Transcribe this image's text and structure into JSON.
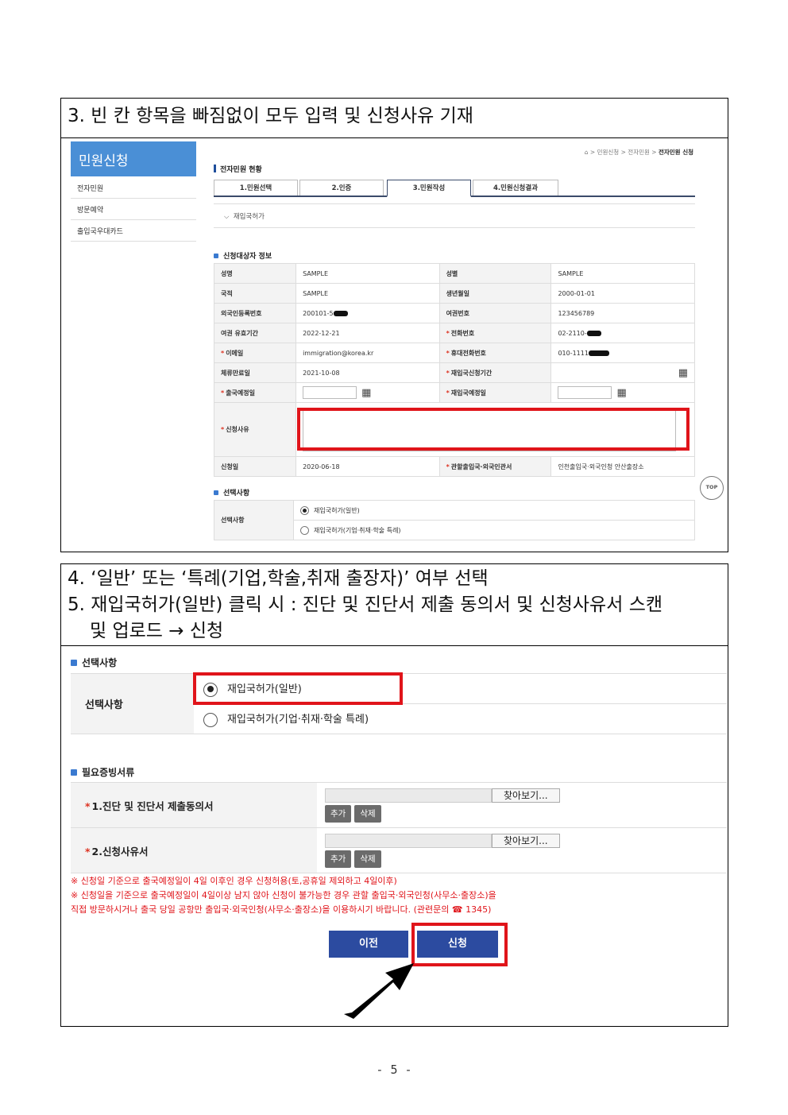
{
  "step3": {
    "title": "3. 빈 칸 항목을 빠짐없이 모두 입력 및 신청사유 기재"
  },
  "shot1": {
    "sidebar": {
      "title": "민원신청",
      "items": [
        "전자민원",
        "방문예약",
        "출입국우대카드"
      ]
    },
    "breadcrumb": {
      "home_icon": "home-icon",
      "parts": [
        "민원신청",
        "전자민원"
      ],
      "current": "전자민원 신청",
      "sep": ">"
    },
    "page_title": "전자민원 현황",
    "tabs": [
      "1.민원선택",
      "2.인증",
      "3.민원작성",
      "4.민원신청결과"
    ],
    "active_tab": 2,
    "collapse_label": "재입국허가",
    "applicant_section": "신청대상자 정보",
    "rows": [
      {
        "l1": "성명",
        "v1": "SAMPLE",
        "l2": "성별",
        "v2": "SAMPLE"
      },
      {
        "l1": "국적",
        "v1": "SAMPLE",
        "l2": "생년월일",
        "v2": "2000-01-01"
      },
      {
        "l1": "외국인등록번호",
        "v1": "200101-5",
        "l2": "여권번호",
        "v2": "123456789"
      },
      {
        "l1": "여권 유효기간",
        "v1": "2022-12-21",
        "l2": "전화번호",
        "v2": "02-2110-"
      },
      {
        "l1": "이메일",
        "v1": "immigration@korea.kr",
        "l2": "휴대전화번호",
        "v2": "010-1111"
      },
      {
        "l1": "체류만료일",
        "v1": "2021-10-08",
        "l2": "재입국신청기간",
        "v2": ""
      },
      {
        "l1": "출국예정일",
        "v1": "",
        "l2": "재입국예정일",
        "v2": ""
      }
    ],
    "reason_label": "신청사유",
    "apply_date_label": "신청일",
    "apply_date": "2020-06-18",
    "office_label": "관할출입국·외국인관서",
    "office_value": "인천출입국·외국인청 안산출장소",
    "choice_section": "선택사항",
    "choice_label": "선택사항",
    "choices": [
      "재입국허가(일반)",
      "재입국허가(기업·취재·학술 특례)"
    ],
    "top_label": "TOP"
  },
  "step45": {
    "line1": "4. ‘일반’ 또는 ‘특례(기업,학술,취재 출장자)’ 여부 선택",
    "line2": "5. 재입국허가(일반) 클릭 시 : 진단 및 진단서 제출 동의서 및 신청사유서 스캔",
    "line3": "및 업로드 → 신청"
  },
  "shot2": {
    "choice_section": "선택사항",
    "choice_label": "선택사항",
    "choices": [
      "재입국허가(일반)",
      "재입국허가(기업·취재·학술 특례)"
    ],
    "docs_section": "필요증빙서류",
    "docs": [
      {
        "label": "1.진단 및 진단서 제출동의서",
        "browse": "찾아보기...",
        "add": "추가",
        "del": "삭제"
      },
      {
        "label": "2.신청사유서",
        "browse": "찾아보기...",
        "add": "추가",
        "del": "삭제"
      }
    ],
    "notices": [
      "※ 신청일 기준으로 출국예정일이 4일 이후인 경우 신청허용(토,공휴일 제외하고 4일이후)",
      "※ 신청일을 기준으로 출국예정일이 4일이상 남지 않아 신청이 불가능한 경우 관할 출입국·외국인청(사무소·출장소)을",
      "직접 방문하시거나 출국 당일 공항만 출입국·외국인청(사무소·출장소)을 이용하시기 바랍니다. (관련문의 ☎ 1345)"
    ],
    "prev_button": "이전",
    "submit_button": "신청"
  },
  "page_number": "- 5 -",
  "colors": {
    "highlight": "#e0141a",
    "button": "#2c4ba0",
    "sidebar": "#4a8fd6"
  }
}
